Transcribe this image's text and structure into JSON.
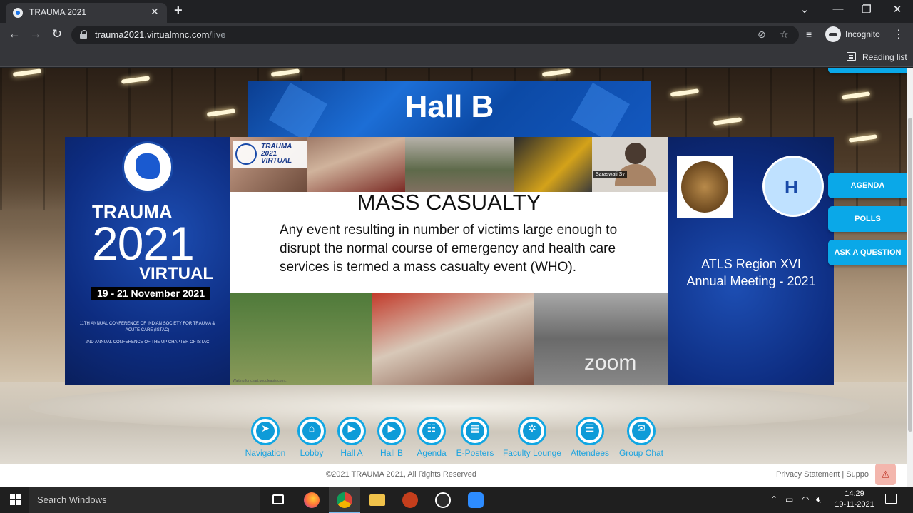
{
  "browser": {
    "tab_title": "TRAUMA 2021",
    "tab_close": "✕",
    "new_tab": "+",
    "url_host": "trauma2021.virtualmnc.com",
    "url_path": "/live",
    "incognito_label": "Incognito",
    "reading_list_label": "Reading list",
    "window_controls": {
      "dropdown": "⌄",
      "minimize": "—",
      "restore": "❐",
      "close": "✕"
    },
    "nav": {
      "back": "←",
      "forward": "→",
      "reload": "↻"
    },
    "omni_icons": {
      "eye_off": "⊘",
      "star": "☆",
      "media": "≡"
    },
    "menu": "⋮"
  },
  "hall": {
    "title": "Hall B"
  },
  "left_panel": {
    "trauma": "TRAUMA",
    "year": "2021",
    "virtual": "VIRTUAL",
    "dates": "19 - 21 November 2021",
    "conference_line1": "11TH ANNUAL CONFERENCE OF INDIAN SOCIETY FOR TRAUMA & ACUTE CARE (ISTAC)",
    "conference_line2": "2ND ANNUAL CONFERENCE OF THE UP CHAPTER OF ISTAC"
  },
  "slide": {
    "logo_text": "TRAUMA 2021 VIRTUAL",
    "heading": "MASS CASUALTY",
    "body": "Any event resulting in number of victims large enough to disrupt the normal course of emergency and health care services is termed a mass casualty event (WHO).",
    "zoom_watermark": "zoom",
    "caption": "Waiting for chart.googleapis.com..."
  },
  "video": {
    "participant_name": "Saraswati Sv"
  },
  "right_panel": {
    "title_line1": "ATLS Region XVI",
    "title_line2": "Annual Meeting - 2021"
  },
  "side_buttons": [
    "AGENDA",
    "POLLS",
    "ASK A QUESTION"
  ],
  "bottom_nav": [
    {
      "label": "Navigation",
      "glyph": "➤",
      "icon": "navigation-icon"
    },
    {
      "label": "Lobby",
      "glyph": "⌂",
      "icon": "lobby-icon"
    },
    {
      "label": "Hall A",
      "glyph": "▶",
      "icon": "hall-a-icon"
    },
    {
      "label": "Hall B",
      "glyph": "▶",
      "icon": "hall-b-icon"
    },
    {
      "label": "Agenda",
      "glyph": "☷",
      "icon": "agenda-icon"
    },
    {
      "label": "E-Posters",
      "glyph": "▦",
      "icon": "e-posters-icon"
    },
    {
      "label": "Faculty Lounge",
      "glyph": "✲",
      "icon": "faculty-lounge-icon"
    },
    {
      "label": "Attendees",
      "glyph": "☰",
      "icon": "attendees-icon"
    },
    {
      "label": "Group Chat",
      "glyph": "✉",
      "icon": "group-chat-icon"
    }
  ],
  "footer": {
    "copyright": "©2021 TRAUMA 2021, All Rights Reserved",
    "links": "Privacy Statement | Suppo",
    "alert_glyph": "⚠"
  },
  "taskbar": {
    "search_placeholder": "Search Windows",
    "time": "14:29",
    "date": "19-11-2021",
    "tray": {
      "chevron": "⌃",
      "battery": "▭",
      "wifi": "◠",
      "mute": "🔇︎"
    }
  },
  "colors": {
    "accent": "#0aa8e8",
    "navy": "#0c2c7c",
    "nav_label": "#1aa3e0"
  }
}
